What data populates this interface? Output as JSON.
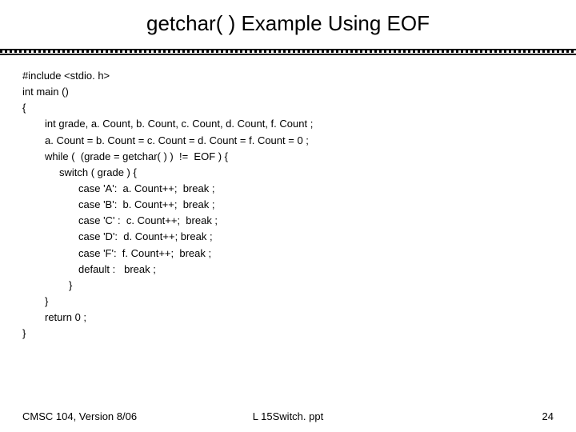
{
  "title": "getchar( ) Example Using EOF",
  "code": {
    "l0": "#include <stdio. h>",
    "l1": "int main ()",
    "l2": "{",
    "l3": "int grade, a. Count, b. Count, c. Count, d. Count, f. Count ;",
    "l4": "a. Count = b. Count = c. Count = d. Count = f. Count = 0 ;",
    "l5": "while (  (grade = getchar( ) )  !=  EOF ) {",
    "l6": "switch ( grade ) {",
    "l7": "case 'A':  a. Count++;  break ;",
    "l8": "case 'B':  b. Count++;  break ;",
    "l9": "case 'C' :  c. Count++;  break ;",
    "l10": "case 'D':  d. Count++; break ;",
    "l11": "case 'F':  f. Count++;  break ;",
    "l12": "default :   break ;",
    "l13": "}",
    "l14": "}",
    "l15": "return 0 ;",
    "l16": "}"
  },
  "footer": {
    "left": "CMSC 104, Version 8/06",
    "center": "L 15Switch. ppt",
    "right": "24"
  }
}
